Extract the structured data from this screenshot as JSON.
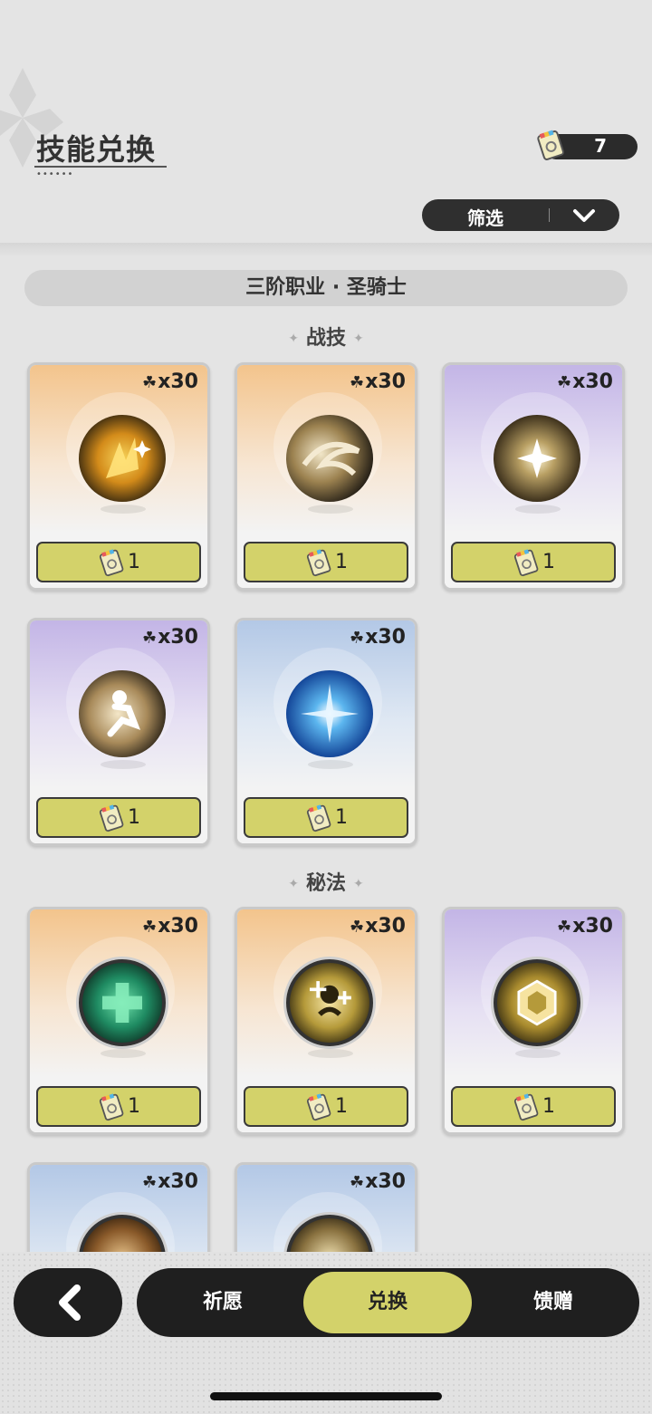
{
  "header": {
    "title": "技能兑换",
    "currency_count": "7"
  },
  "filter": {
    "label": "筛选"
  },
  "class_banner": "三阶职业 · 圣骑士",
  "sections": [
    {
      "title": "战技",
      "cards": [
        {
          "cost": "x30",
          "price": "1",
          "color": "orange",
          "icon": "flame-slash-icon"
        },
        {
          "cost": "x30",
          "price": "1",
          "color": "orange",
          "icon": "wind-swirl-icon"
        },
        {
          "cost": "x30",
          "price": "1",
          "color": "purple",
          "icon": "sparkle-star-icon"
        },
        {
          "cost": "x30",
          "price": "1",
          "color": "purple",
          "icon": "dash-runner-icon"
        },
        {
          "cost": "x30",
          "price": "1",
          "color": "blue",
          "icon": "blue-burst-icon"
        }
      ]
    },
    {
      "title": "秘法",
      "cards": [
        {
          "cost": "x30",
          "price": "1",
          "color": "orange",
          "icon": "green-heal-cross-icon"
        },
        {
          "cost": "x30",
          "price": "1",
          "color": "orange",
          "icon": "group-heal-icon"
        },
        {
          "cost": "x30",
          "price": "1",
          "color": "purple",
          "icon": "hexagon-shield-icon"
        },
        {
          "cost": "x30",
          "price": "",
          "color": "blue",
          "icon": "sun-emblem-icon"
        },
        {
          "cost": "x30",
          "price": "",
          "color": "blue",
          "icon": "tree-emblem-icon"
        }
      ]
    }
  ],
  "tabs": [
    {
      "label": "祈愿"
    },
    {
      "label": "兑换"
    },
    {
      "label": "馈赠"
    }
  ]
}
